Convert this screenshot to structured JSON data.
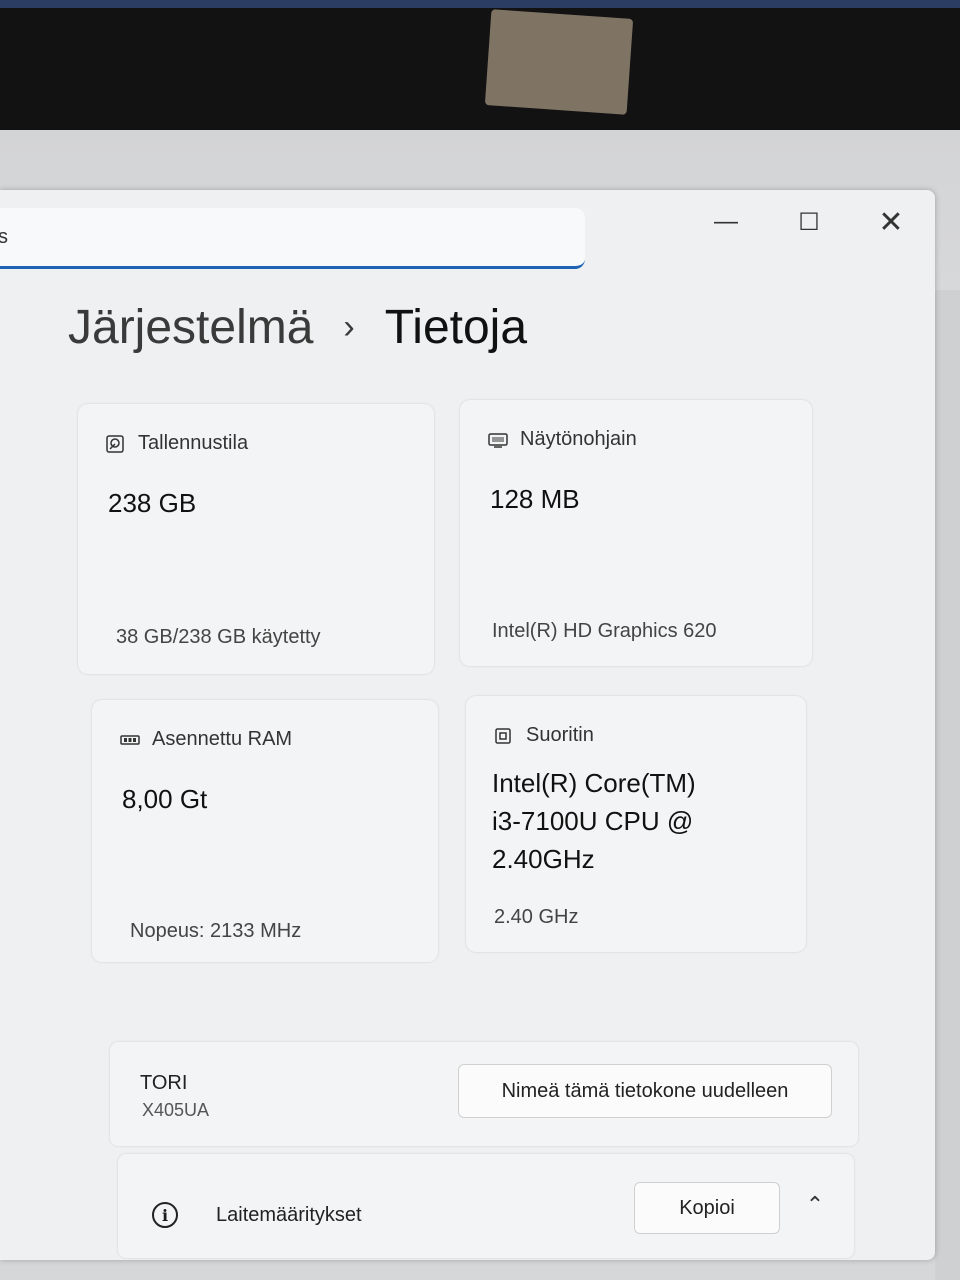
{
  "window": {
    "search_fragment": "s",
    "minimize_glyph": "—",
    "maximize_glyph": "☐",
    "close_glyph": "✕"
  },
  "breadcrumb": {
    "parent": "Järjestelmä",
    "separator": "›",
    "current": "Tietoja"
  },
  "cards": {
    "storage": {
      "title": "Tallennustila",
      "value": "238 GB",
      "detail": "38 GB/238 GB käytetty",
      "icon": "drive-icon"
    },
    "gpu": {
      "title": "Näytönohjain",
      "value": "128 MB",
      "detail": "Intel(R) HD Graphics 620",
      "icon": "display-icon"
    },
    "ram": {
      "title": "Asennettu RAM",
      "value": "8,00 Gt",
      "detail": "Nopeus: 2133 MHz",
      "icon": "memory-icon"
    },
    "cpu": {
      "title": "Suoritin",
      "value_lines": [
        "Intel(R) Core(TM)",
        "i3-7100U CPU @",
        "2.40GHz"
      ],
      "detail": "2.40 GHz",
      "icon": "processor-icon"
    }
  },
  "device": {
    "name": "TORI",
    "model": "X405UA",
    "rename_label": "Nimeä tämä tietokone uudelleen"
  },
  "specs": {
    "label": "Laitemääritykset",
    "info_glyph": "i",
    "copy_label": "Kopioi",
    "chevron_glyph": "⌃"
  },
  "colors": {
    "accent": "#1e63b4",
    "card_bg": "#f3f4f5",
    "window_bg": "#eef0f1"
  }
}
